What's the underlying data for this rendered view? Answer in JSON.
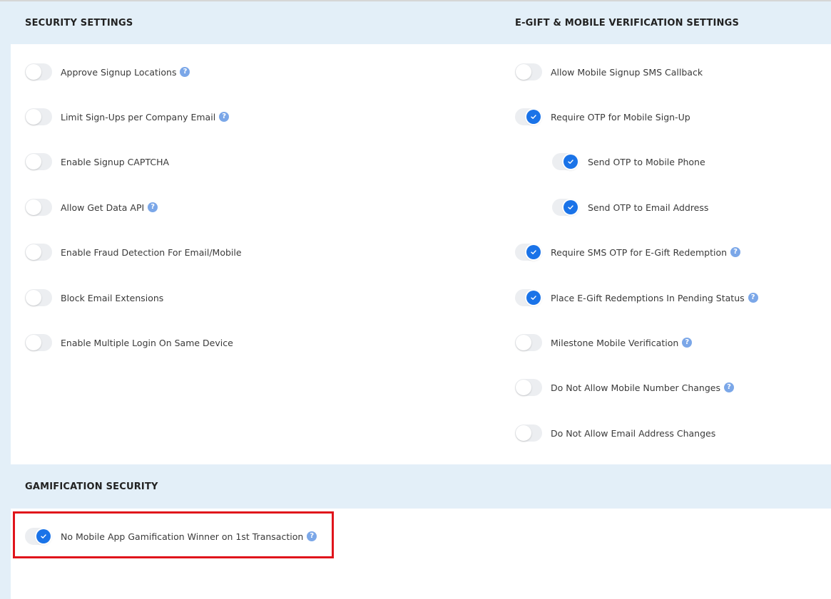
{
  "security": {
    "title": "SECURITY SETTINGS",
    "items": [
      {
        "label": "Approve Signup Locations",
        "on": false,
        "help": true
      },
      {
        "label": "Limit Sign-Ups per Company Email",
        "on": false,
        "help": true
      },
      {
        "label": "Enable Signup CAPTCHA",
        "on": false,
        "help": false
      },
      {
        "label": "Allow Get Data API",
        "on": false,
        "help": true
      },
      {
        "label": "Enable Fraud Detection For Email/Mobile",
        "on": false,
        "help": false
      },
      {
        "label": "Block Email Extensions",
        "on": false,
        "help": false
      },
      {
        "label": "Enable Multiple Login On Same Device",
        "on": false,
        "help": false
      }
    ]
  },
  "egift": {
    "title": "E-GIFT & MOBILE VERIFICATION SETTINGS",
    "items": [
      {
        "label": "Allow Mobile Signup SMS Callback",
        "on": false,
        "help": false
      },
      {
        "label": "Require OTP for Mobile Sign-Up",
        "on": true,
        "help": false
      },
      {
        "label": "Send OTP to Mobile Phone",
        "on": true,
        "help": false
      },
      {
        "label": "Send OTP to Email Address",
        "on": true,
        "help": false
      },
      {
        "label": "Require SMS OTP for E-Gift Redemption",
        "on": true,
        "help": true
      },
      {
        "label": "Place E-Gift Redemptions In Pending Status",
        "on": true,
        "help": true
      },
      {
        "label": "Milestone Mobile Verification",
        "on": false,
        "help": true
      },
      {
        "label": "Do Not Allow Mobile Number Changes",
        "on": false,
        "help": true
      },
      {
        "label": "Do Not Allow Email Address Changes",
        "on": false,
        "help": false
      }
    ]
  },
  "gamification": {
    "title": "GAMIFICATION SECURITY",
    "items": [
      {
        "label": "No Mobile App Gamification Winner on 1st Transaction",
        "on": true,
        "help": true
      }
    ]
  },
  "help_glyph": "?",
  "colors": {
    "accent": "#1a73e8",
    "help": "#7ba7e8",
    "header_bg": "#e3eff8",
    "highlight": "#e0141b"
  }
}
